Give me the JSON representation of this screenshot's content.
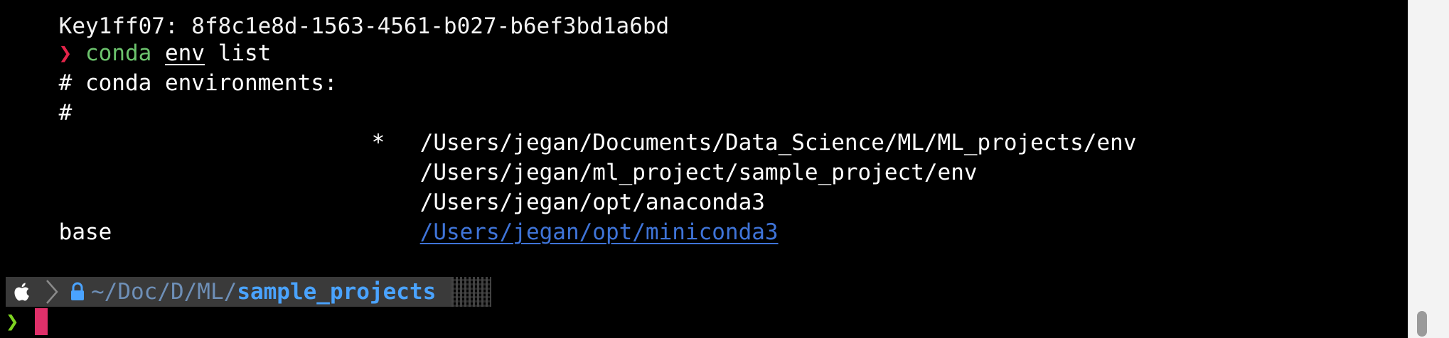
{
  "terminal": {
    "partial_top_line": "Key1ff07: 8f8c1e8d-1563-4561-b027-b6ef3bd1a6bd",
    "prompt_symbol": "❯",
    "command": {
      "word1": "conda",
      "word2": "env",
      "word3": "list"
    },
    "header_line_1": "# conda environments:",
    "header_line_2": "#",
    "environments": [
      {
        "name": "",
        "active_marker": "*",
        "path": "/Users/jegan/Documents/Data_Science/ML/ML_projects/env"
      },
      {
        "name": "",
        "active_marker": "",
        "path": "/Users/jegan/ml_project/sample_project/env"
      },
      {
        "name": "",
        "active_marker": "",
        "path": "/Users/jegan/opt/anaconda3"
      },
      {
        "name": "base",
        "active_marker": "",
        "path": "/Users/jegan/opt/miniconda3"
      }
    ],
    "powerline": {
      "os_icon": "apple-icon",
      "separator_icon": "chevron-right-icon",
      "lock_icon": "lock-icon",
      "dir_prefix": "~/Doc/D/ML/",
      "dir_current": "sample_projects"
    },
    "input_prompt_symbol": "❯"
  },
  "colors": {
    "prompt_red": "#e5244a",
    "prompt_green": "#7ed321",
    "command_green": "#6cc36d",
    "link_blue": "#3f74d8",
    "dir_blue": "#4aa3ff",
    "cursor_pink": "#e0306a"
  }
}
